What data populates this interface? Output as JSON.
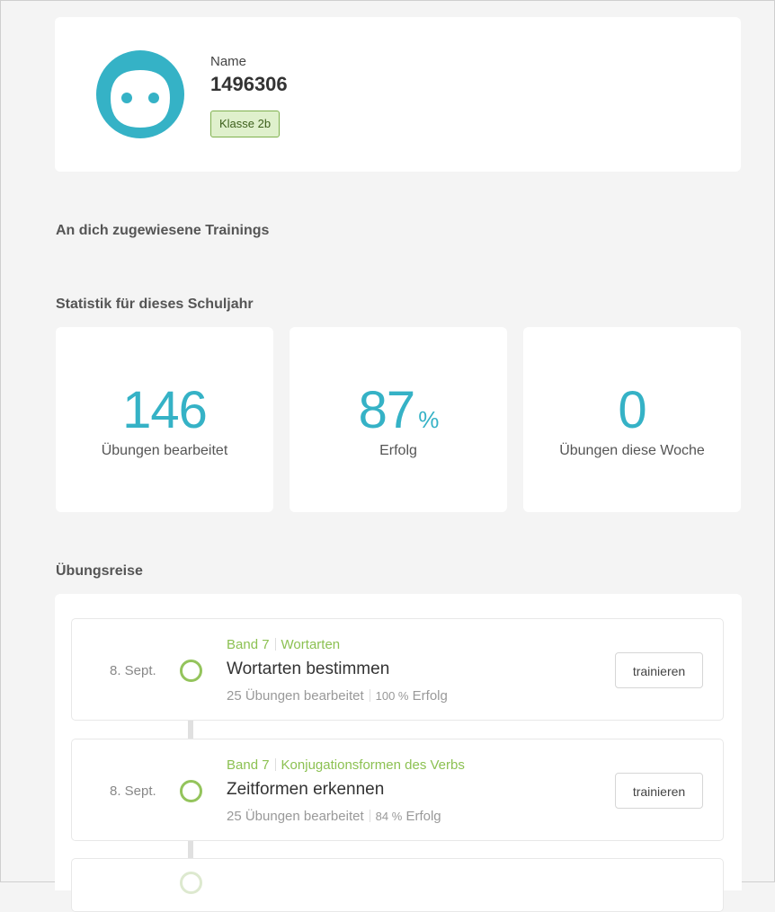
{
  "profile": {
    "name_label": "Name",
    "user_id": "1496306",
    "class_badge": "Klasse 2b",
    "avatar_color": "#35b2c6"
  },
  "sections": {
    "trainings": "An dich zugewiesene Trainings",
    "stats": "Statistik für dieses Schuljahr",
    "journey": "Übungsreise"
  },
  "stats": [
    {
      "value": "146",
      "unit": "",
      "label": "Übungen bearbeitet"
    },
    {
      "value": "87",
      "unit": "%",
      "label": "Erfolg"
    },
    {
      "value": "0",
      "unit": "",
      "label": "Übungen diese Woche"
    }
  ],
  "journey": [
    {
      "date": "8. Sept.",
      "band": "Band 7",
      "topic": "Wortarten",
      "title": "Wortarten bestimmen",
      "count_text": "25 Übungen bearbeitet",
      "percent": "100 %",
      "success_label": "Erfolg",
      "button": "trainieren"
    },
    {
      "date": "8. Sept.",
      "band": "Band 7",
      "topic": "Konjugationsformen des Verbs",
      "title": "Zeitformen erkennen",
      "count_text": "25 Übungen bearbeitet",
      "percent": "84 %",
      "success_label": "Erfolg",
      "button": "trainieren"
    }
  ],
  "colors": {
    "accent": "#35b2c6",
    "green": "#8cc152",
    "background": "#f4f4f4"
  }
}
